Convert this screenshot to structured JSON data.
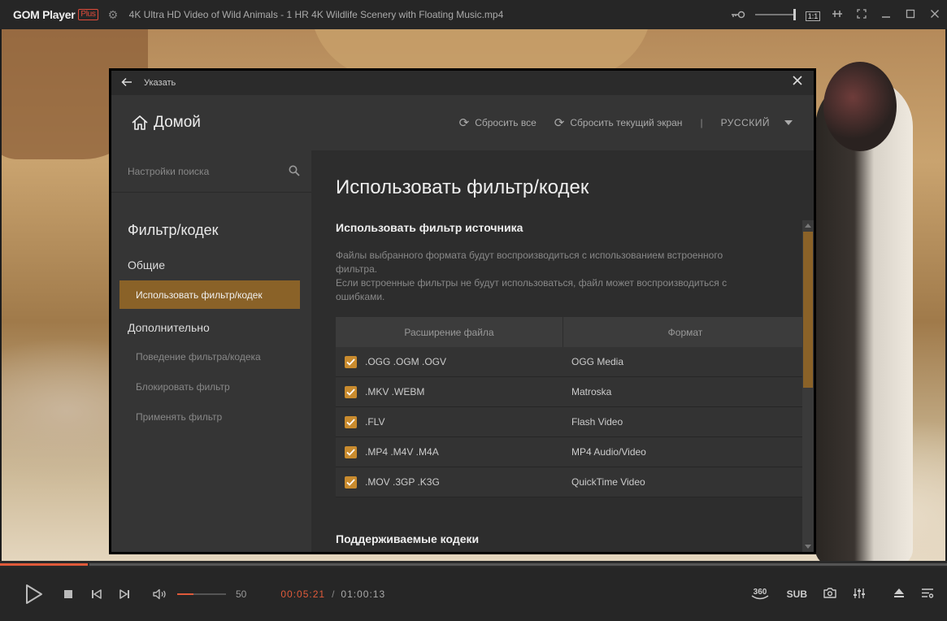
{
  "titlebar": {
    "brand": "GOM Player",
    "brand_plus": "Plus",
    "file_title": "4K Ultra HD Video of Wild Animals - 1 HR 4K Wildlife Scenery with Floating Music.mp4",
    "ratio_badge": "1:1"
  },
  "dialog": {
    "top_title": "Указать",
    "home_label": "Домой",
    "reset_all": "Сбросить все",
    "reset_current": "Сбросить текущий экран",
    "separator": "|",
    "language": "РУССКИЙ"
  },
  "sidebar": {
    "search_placeholder": "Настройки поиска",
    "section_title": "Фильтр/кодек",
    "group_general": "Общие",
    "active_item": "Использовать фильтр/кодек",
    "group_advanced": "Дополнительно",
    "items": [
      "Поведение фильтра/кодека",
      "Блокировать фильтр",
      "Применять фильтр"
    ]
  },
  "content": {
    "title": "Использовать фильтр/кодек",
    "subtitle": "Использовать фильтр источника",
    "desc_line1": "Файлы выбранного формата будут воспроизводиться с использованием встроенного фильтра.",
    "desc_line2": "Если встроенные фильтры не будут использоваться, файл может воспроизводиться с ошибками.",
    "table": {
      "col_ext": "Расширение файла",
      "col_format": "Формат",
      "rows": [
        {
          "ext": ".OGG .OGM .OGV",
          "format": "OGG Media",
          "checked": true
        },
        {
          "ext": ".MKV .WEBM",
          "format": "Matroska",
          "checked": true
        },
        {
          "ext": ".FLV",
          "format": "Flash Video",
          "checked": true
        },
        {
          "ext": ".MP4 .M4V .M4A",
          "format": "MP4 Audio/Video",
          "checked": true
        },
        {
          "ext": ".MOV .3GP .K3G",
          "format": "QuickTime Video",
          "checked": true
        }
      ]
    },
    "subtitle2": "Поддерживаемые кодеки"
  },
  "player": {
    "volume": "50",
    "volume_fraction": 0.33,
    "seek_fraction": 0.093,
    "time_current": "00:05:21",
    "time_separator": "/",
    "time_total": "01:00:13",
    "btn_360": "360",
    "btn_sub": "SUB"
  },
  "colors": {
    "accent": "#8a6228",
    "checkbox": "#c98b2e",
    "progress": "#e05a3a"
  }
}
